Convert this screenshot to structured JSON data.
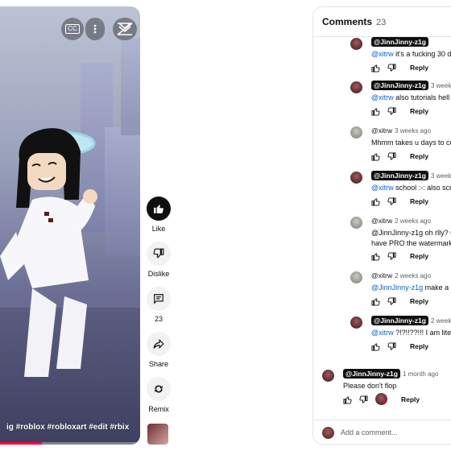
{
  "video": {
    "caption": "ig #roblox #robloxart #edit #rbix",
    "progress_fraction": 0.3,
    "buttons": {
      "cc": "CC"
    }
  },
  "actions": {
    "like": "Like",
    "dislike": "Dislike",
    "comments_count": "23",
    "share": "Share",
    "remix": "Remix"
  },
  "comments_panel": {
    "title": "Comments",
    "count": "23",
    "add_placeholder": "Add a comment...",
    "reply_label": "Reply",
    "items": [
      {
        "handle": "@JinnJinny-z1g",
        "time": "",
        "mention": "@xitrw",
        "text": " it's a fucking 30 d"
      },
      {
        "handle": "@JinnJinny-z1g",
        "time": "3 weeks",
        "mention": "@xitrw",
        "text": " also tutorials hell"
      },
      {
        "handle": "@xitrw",
        "time": "3 weeks ago",
        "mention": "",
        "text": "Mhmm takes u days to co"
      },
      {
        "handle": "@JinnJinny-z1g",
        "time": "3 weeks",
        "mention": "@xitrw",
        "text": " school :-: also scr"
      },
      {
        "handle": "@xitrw",
        "time": "2 weeks ago",
        "mention": "",
        "text": "@JinnJinny-z1g oh rlly? C",
        "text2": "have PRO the watermark"
      },
      {
        "handle": "@xitrw",
        "time": "2 weeks ago",
        "mention": "@JinnJinny-z1g",
        "text": " make a"
      },
      {
        "handle": "@JinnJinny-z1g",
        "time": "2 weeks",
        "mention": "@xitrw",
        "text": " ?!?!!??!!! I am liter"
      },
      {
        "handle": "@JinnJinny-z1g",
        "time": "1 month ago",
        "mention": "",
        "text": "Please don't flop"
      }
    ]
  },
  "colors": {
    "accent": "#065fd4",
    "brand_red": "#ff0033",
    "badge_bg": "#0f0f0f"
  }
}
